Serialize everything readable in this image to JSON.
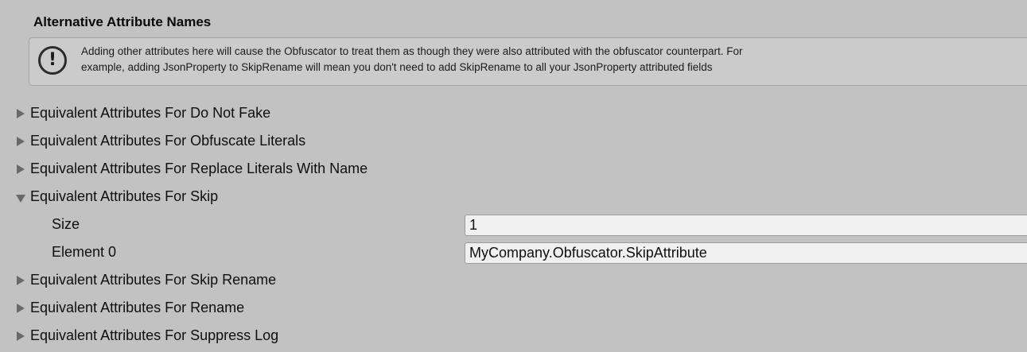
{
  "section": {
    "title": "Alternative Attribute Names"
  },
  "helpbox": {
    "icon": "exclamation-icon",
    "line1": "Adding other attributes here will cause the Obfuscator to treat them as though they were also attributed with the obfuscator counterpart. For",
    "line2": "example, adding JsonProperty to SkipRename will mean you don't need to add SkipRename to all your JsonProperty attributed fields"
  },
  "foldouts": [
    {
      "label": "Equivalent Attributes For Do Not Fake",
      "expanded": false
    },
    {
      "label": "Equivalent Attributes For Obfuscate Literals",
      "expanded": false
    },
    {
      "label": "Equivalent Attributes For Replace Literals With Name",
      "expanded": false
    },
    {
      "label": "Equivalent Attributes For Skip",
      "expanded": true
    },
    {
      "label": "Equivalent Attributes For Skip Rename",
      "expanded": false
    },
    {
      "label": "Equivalent Attributes For Rename",
      "expanded": false
    },
    {
      "label": "Equivalent Attributes For Suppress Log",
      "expanded": false
    }
  ],
  "skip_array": {
    "size_label": "Size",
    "size_value": "1",
    "element_label": "Element 0",
    "element_value": "MyCompany.Obfuscator.SkipAttribute"
  }
}
